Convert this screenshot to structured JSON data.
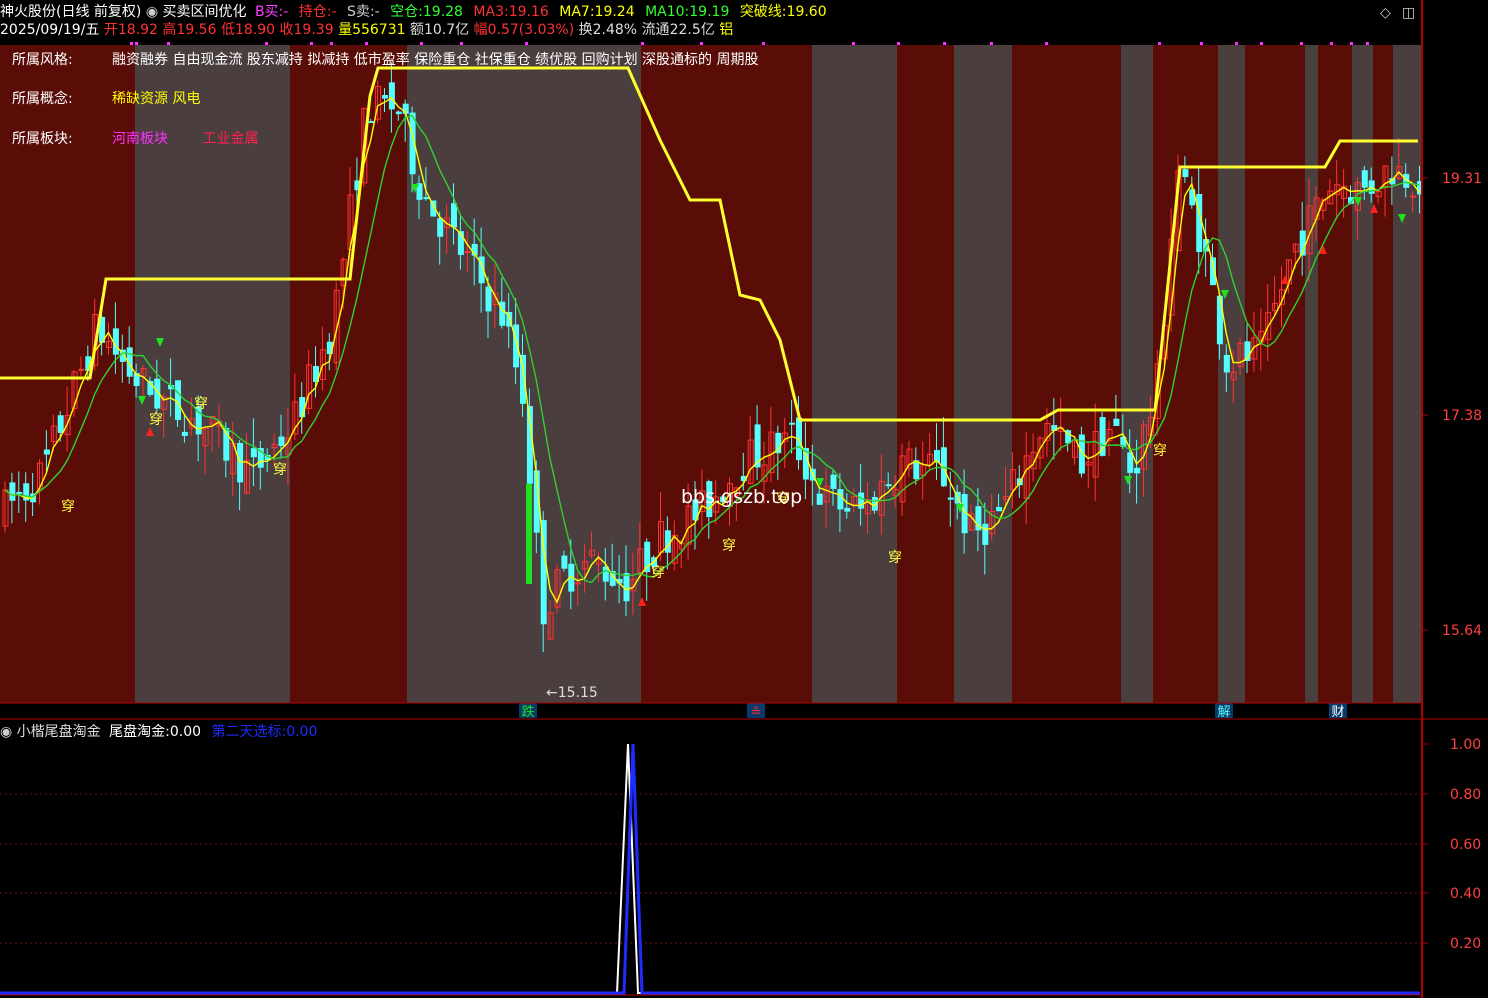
{
  "header": {
    "stock": "神火股份(日线 前复权)",
    "formula": "买卖区间优化",
    "b_label": "B买:",
    "b_value": "-",
    "hold_label": "持仓:",
    "hold_value": "-",
    "s_label": "S卖:",
    "s_value": "-",
    "empty_label": "空仓:",
    "empty_value": "19.28",
    "ma3_label": "MA3:",
    "ma3_value": "19.16",
    "ma7_label": "MA7:",
    "ma7_value": "19.24",
    "ma10_label": "MA10:",
    "ma10_value": "19.19",
    "break_label": "突破线:",
    "break_value": "19.60"
  },
  "quote": {
    "date": "2025/09/19/五",
    "open_label": "开",
    "open": "18.92",
    "high_label": "高",
    "high": "19.56",
    "low_label": "低",
    "low": "18.90",
    "close_label": "收",
    "close": "19.39",
    "vol_label": "量",
    "vol": "556731",
    "amount_label": "额",
    "amount": "10.7亿",
    "chg_label": "幅",
    "chg": "0.57(3.03%)",
    "turnover_label": "换",
    "turnover": "2.48%",
    "float_label": "流通",
    "float": "22.5亿",
    "sector": "铝"
  },
  "info": {
    "style_label": "所属风格:",
    "style_value": "融资融券 自由现金流 股东减持 拟减持 低市盈率 保险重仓 社保重仓 绩优股 回购计划 深股通标的 周期股",
    "concept_label": "所属概念:",
    "concept_value": "稀缺资源 风电",
    "block_label": "所属板块:",
    "block_value1": "河南板块",
    "block_value2": "工业金属"
  },
  "price_axis": [
    "19.31",
    "17.38",
    "15.64"
  ],
  "low_marker": "←15.15",
  "watermark_site": "bbs.gszb.top",
  "bottom_markers": [
    "跌",
    "≗",
    "解",
    "财"
  ],
  "signals": [
    "穿",
    "穿",
    "穿",
    "穿",
    "穿",
    "穿",
    "穿",
    "穿",
    "穿"
  ],
  "indicator": {
    "name": "小楷尾盘淘金",
    "line1_label": "尾盘淘金:",
    "line1_value": "0.00",
    "line2_label": "第二天选标:",
    "line2_value": "0.00",
    "axis": [
      "1.00",
      "0.80",
      "0.60",
      "0.40",
      "0.20"
    ]
  },
  "colors": {
    "up": "#ff3232",
    "down": "#54ffff",
    "ma3": "#ffff00",
    "ma7": "#30d030",
    "break_line": "#ffff30",
    "band_dark": "#5a0d07",
    "band_gray": "#4a3e3f",
    "axis": "#b00000"
  }
}
